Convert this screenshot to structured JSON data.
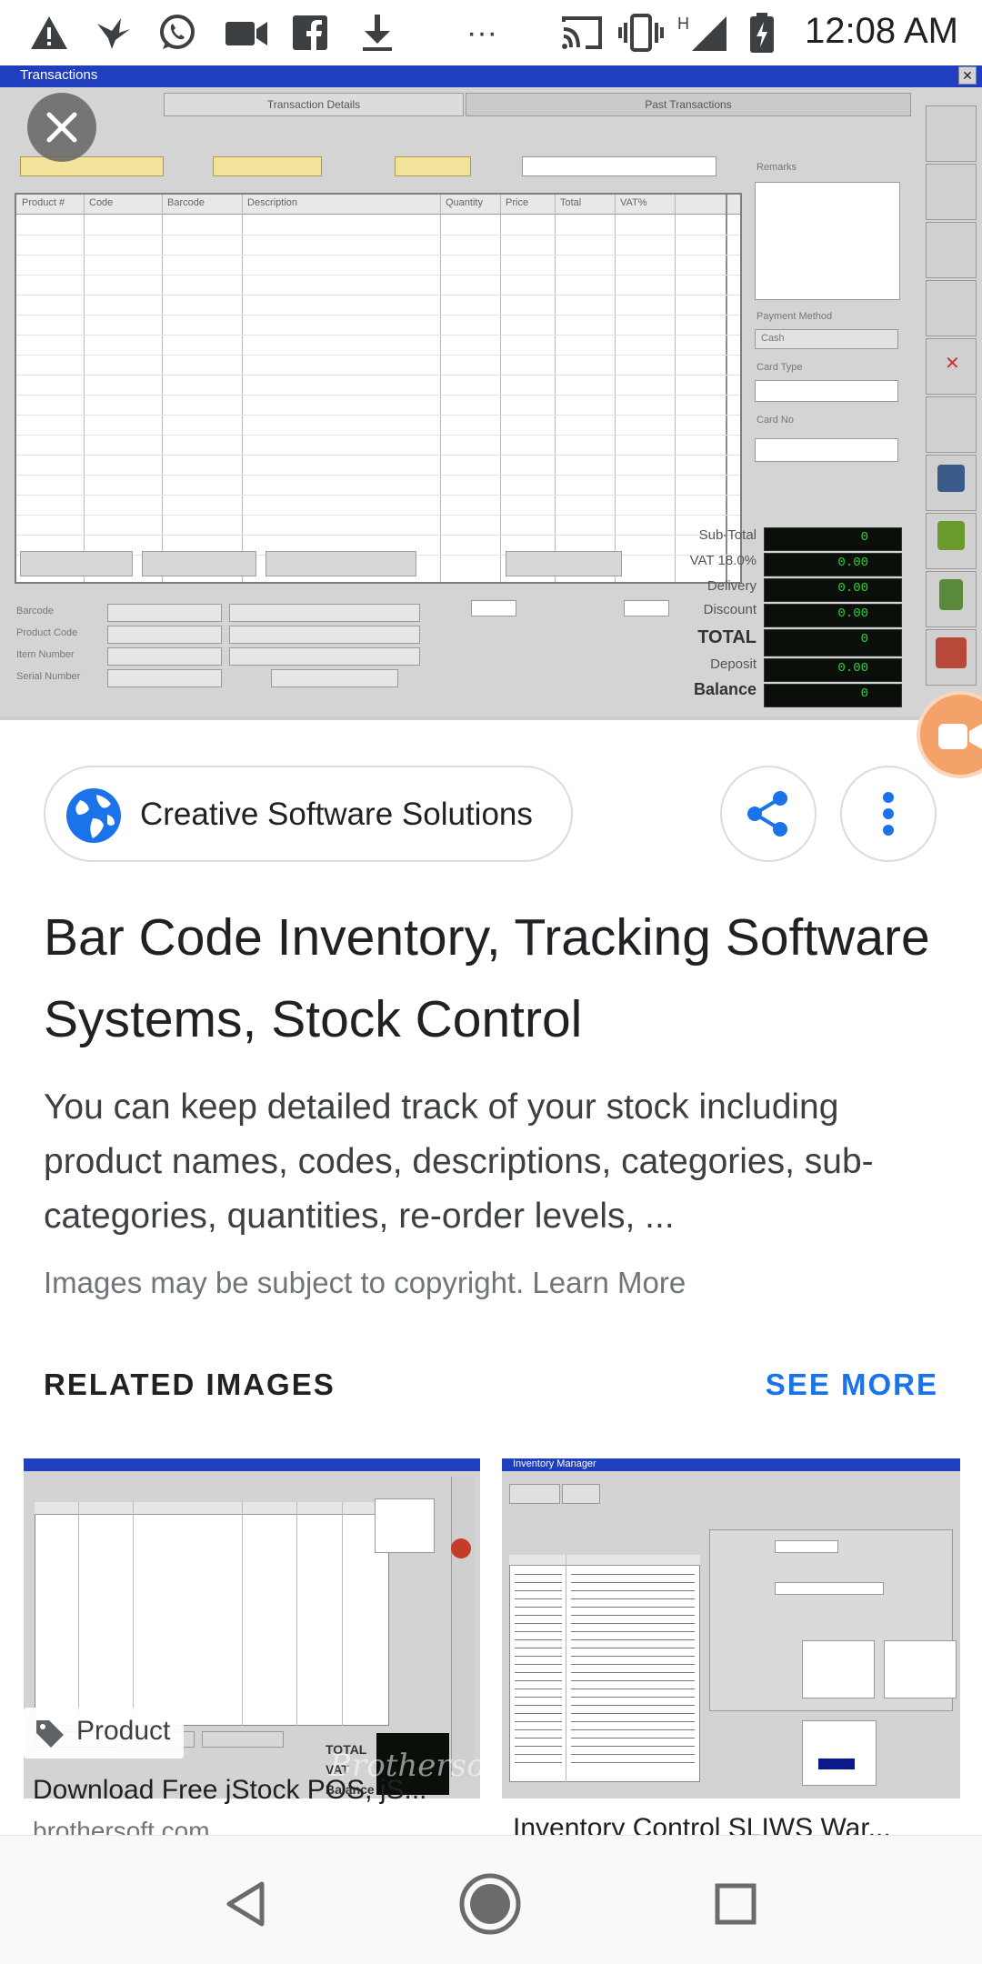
{
  "status_bar": {
    "time": "12:08 AM",
    "more": "···",
    "network": "H",
    "icons": [
      "alert-icon",
      "bird-icon",
      "whatsapp-icon",
      "video-call-icon",
      "facebook-icon",
      "download-icon",
      "cast-icon",
      "vibrate-icon",
      "signal-icon",
      "battery-charging-icon"
    ]
  },
  "preview": {
    "window_title": "Transactions",
    "tab_left": "Transaction Details",
    "tab_right": "Past Transactions",
    "columns": [
      "Product #",
      "Code",
      "Barcode",
      "Description",
      "Quantity",
      "Price",
      "Total",
      "VAT%"
    ],
    "totals_labels": [
      "Sub-Total",
      "VAT 18.0%",
      "Delivery",
      "Discount",
      "TOTAL",
      "Deposit",
      "Balance"
    ],
    "totals_values": [
      "0",
      "0.00",
      "0.00",
      "0.00",
      "0",
      "0.00",
      "0"
    ],
    "right_labels": [
      "Remarks",
      "Payment Method",
      "Card Type",
      "Card No"
    ],
    "payment_method": "Cash",
    "left_labels": [
      "Barcode",
      "Product Code",
      "Item Number",
      "Serial Number"
    ]
  },
  "result": {
    "source": "Creative Software Solutions",
    "title": "Bar Code Inventory, Tracking Software Systems, Stock Control",
    "description": "You can keep detailed track of your stock including product names, codes, descriptions, categories, sub-categories, quantities, re-order levels, ...",
    "copyright": "Images may be subject to copyright. Learn More"
  },
  "related": {
    "heading": "RELATED IMAGES",
    "see_more": "SEE MORE",
    "items": [
      {
        "caption": "Download Free jStock POS, jS...",
        "domain": "brothersoft.com",
        "badge": "Product",
        "watermark": "Brothersoft"
      },
      {
        "caption": "Inventory Control SLIWS War...",
        "domain": "",
        "window_title": "Inventory Manager"
      }
    ]
  },
  "colors": {
    "accent": "#1a73e8",
    "globe": "#1a73e8",
    "fab": "#f4a16a",
    "win_title": "#1f3fbf",
    "lcd_green": "#2bd23a"
  }
}
